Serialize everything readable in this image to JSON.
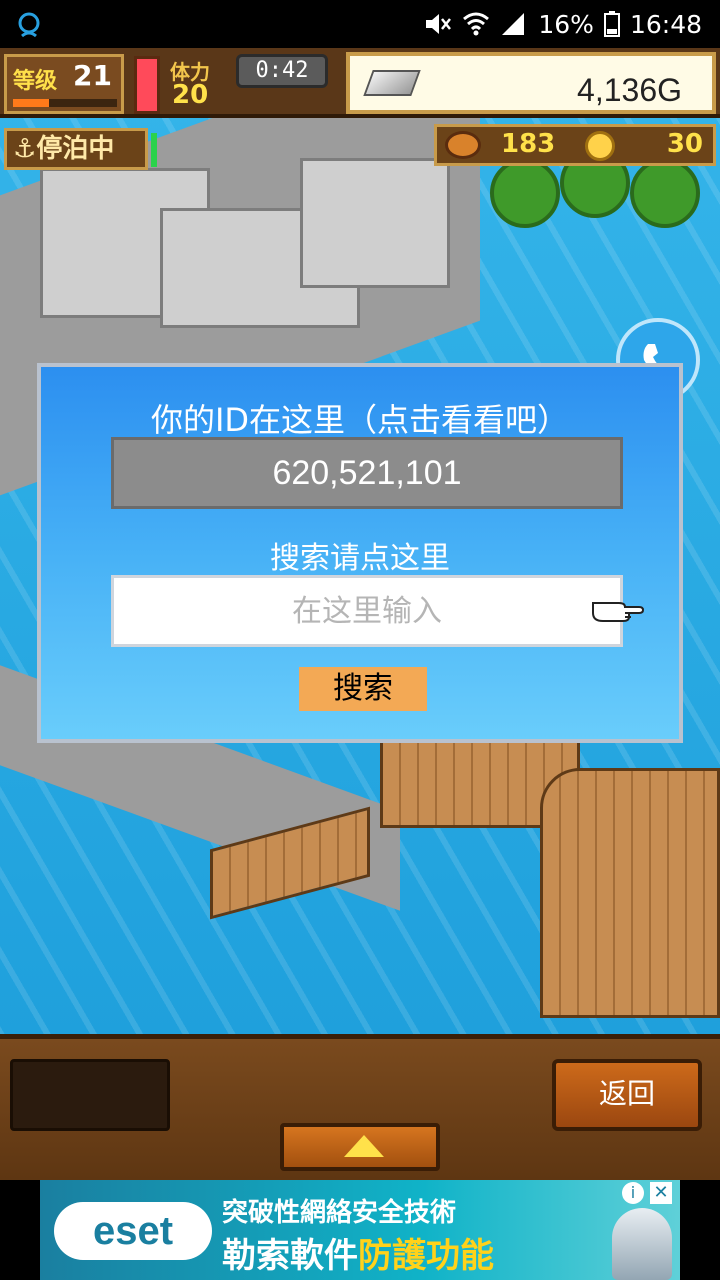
{
  "status_bar": {
    "battery": "16%",
    "time": "16:48",
    "icons": [
      "notification-icon",
      "mute-icon",
      "wifi-icon",
      "signal-icon",
      "battery-icon"
    ]
  },
  "hud": {
    "level_label": "等级",
    "level_value": "21",
    "level_progress": 0.35,
    "stamina_label": "体力",
    "stamina_value": "20",
    "timer": "0:42",
    "gold": "4,136G",
    "anchor_status": "停泊中",
    "food": "183",
    "coins": "30"
  },
  "dialog": {
    "title": "你的ID在这里（点击看看吧）",
    "id_value": "620,521,101",
    "search_prompt": "搜索请点这里",
    "search_placeholder": "在这里输入",
    "search_button": "搜索"
  },
  "bottom": {
    "back_label": "返回"
  },
  "ad": {
    "logo": "eset",
    "line1": "突破性網絡安全技術",
    "line2_plain": "勒索軟件",
    "line2_highlight": "防護功能",
    "info": "i",
    "close": "✕"
  },
  "colors": {
    "dialog_top": "#2c8ff0",
    "dialog_bottom": "#69cdfb",
    "id_box": "#8c8c8c",
    "search_button": "#f3a955",
    "back_button": "#cd6a1a",
    "hud_brown": "#6b4318",
    "gold_text": "#ffe14a"
  }
}
